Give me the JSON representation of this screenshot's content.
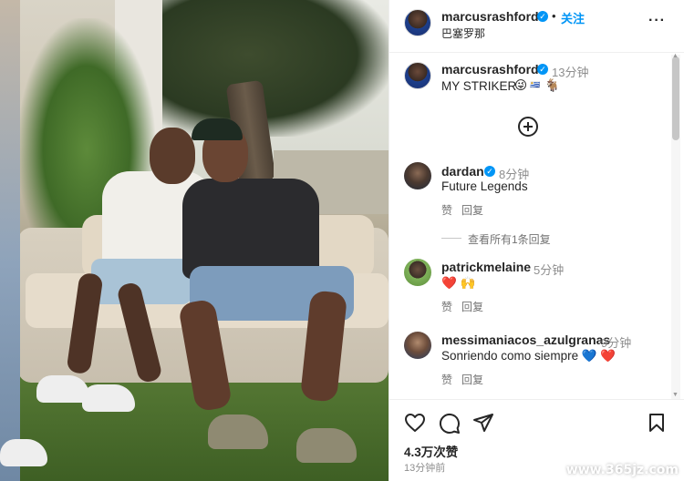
{
  "post": {
    "owner": "marcusrashford",
    "follow_label": "关注",
    "separator": "•",
    "location": "巴塞罗那",
    "caption": "MY STRIKER",
    "caption_emoji": "😜",
    "caption_flag": "🇺🇾",
    "caption_extra": "🐐",
    "caption_time": "13分钟"
  },
  "comments": [
    {
      "user": "dardan",
      "verified": true,
      "time": "8分钟",
      "text": "Future Legends",
      "like_label": "赞",
      "reply_label": "回复",
      "view_replies": "查看所有1条回复"
    },
    {
      "user": "patrickmelaine",
      "verified": false,
      "time": "5分钟",
      "text": "❤️ 🙌",
      "like_label": "赞",
      "reply_label": "回复"
    },
    {
      "user": "messimaniacos_azulgranas",
      "verified": false,
      "time": "9分钟",
      "text": "Sonriendo como siempre 💙 ❤️",
      "like_label": "赞",
      "reply_label": "回复"
    }
  ],
  "footer": {
    "likes": "4.3万次赞",
    "ago": "13分钟前"
  },
  "watermark": "www.365jz.com",
  "icons": {
    "like": "heart-icon",
    "comment": "comment-icon",
    "share": "share-icon",
    "save": "bookmark-icon",
    "more": "more-icon",
    "verified": "verified-badge-icon",
    "expand": "plus-circle-icon"
  },
  "colors": {
    "accent": "#0095f6",
    "text": "#262626",
    "muted": "#8e8e8e",
    "heart": "#ed4956"
  }
}
